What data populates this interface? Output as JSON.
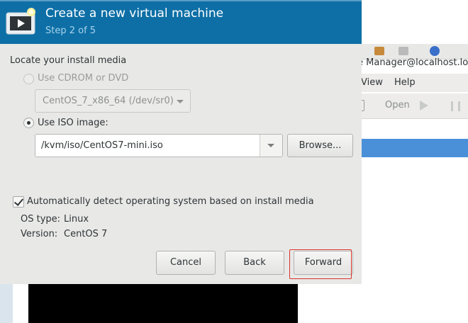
{
  "background_window": {
    "title": "e Manager@localhost.loc",
    "menu": {
      "view": "View",
      "help": "Help"
    },
    "toolbar": {
      "open": "Open"
    }
  },
  "dialog": {
    "title": "Create a new virtual machine",
    "step": "Step 2 of 5",
    "section_label": "Locate your install media",
    "cdrom": {
      "label": "Use CDROM or DVD",
      "selected": false,
      "enabled": false,
      "device": "CentOS_7_x86_64 (/dev/sr0)"
    },
    "iso": {
      "label": "Use ISO image:",
      "selected": true,
      "path": "/kvm/iso/CentOS7-mini.iso",
      "browse_label": "Browse..."
    },
    "autodetect": {
      "label": "Automatically detect operating system based on install media",
      "checked": true
    },
    "os_info": {
      "os_type_key": "OS type:",
      "os_type_value": "Linux",
      "version_key": "Version:",
      "version_value": "CentOS 7"
    },
    "buttons": {
      "cancel": "Cancel",
      "back": "Back",
      "forward": "Forward"
    }
  },
  "colors": {
    "header_bg": "#0d6fa6",
    "selection_blue": "#4a90d9",
    "highlight_red": "#d9342b"
  }
}
